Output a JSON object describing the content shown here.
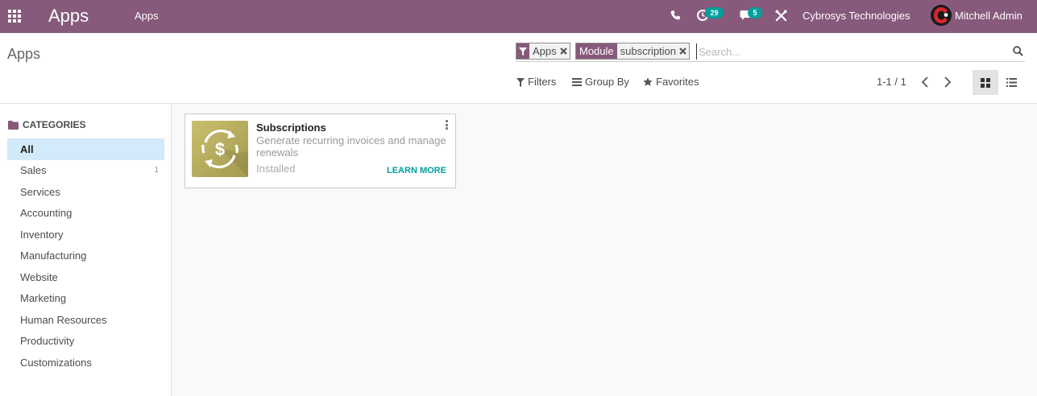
{
  "navbar": {
    "brand": "Apps",
    "menu_item": "Apps",
    "activity_count": "29",
    "chat_count": "5",
    "company": "Cybrosys Technologies",
    "user_name": "Mitchell Admin",
    "icons": [
      "apps-grid-icon",
      "phone-icon",
      "activity-clock-icon",
      "chat-icon",
      "debug-tools-icon"
    ],
    "accent_color": "#875a7b"
  },
  "control_panel": {
    "title": "Apps",
    "search": {
      "facets": [
        {
          "label_icon": "filter-icon",
          "value": "Apps"
        },
        {
          "label": "Module",
          "value": "subscription"
        }
      ],
      "placeholder": "Search..."
    },
    "filters_label": "Filters",
    "groupby_label": "Group By",
    "favorites_label": "Favorites",
    "pager_value": "1-1 / 1",
    "views": [
      "kanban-view-icon",
      "list-view-icon"
    ],
    "active_view": "kanban"
  },
  "sidebar": {
    "header": "CATEGORIES",
    "items": [
      {
        "label": "All",
        "count": "",
        "active": true
      },
      {
        "label": "Sales",
        "count": "1"
      },
      {
        "label": "Services",
        "count": ""
      },
      {
        "label": "Accounting",
        "count": ""
      },
      {
        "label": "Inventory",
        "count": ""
      },
      {
        "label": "Manufacturing",
        "count": ""
      },
      {
        "label": "Website",
        "count": ""
      },
      {
        "label": "Marketing",
        "count": ""
      },
      {
        "label": "Human Resources",
        "count": ""
      },
      {
        "label": "Productivity",
        "count": ""
      },
      {
        "label": "Customizations",
        "count": ""
      }
    ]
  },
  "cards": [
    {
      "title": "Subscriptions",
      "description": "Generate recurring invoices and manage renewals",
      "status": "Installed",
      "action_label": "LEARN MORE",
      "icon": "subscription-dollar-cycle-icon"
    }
  ]
}
